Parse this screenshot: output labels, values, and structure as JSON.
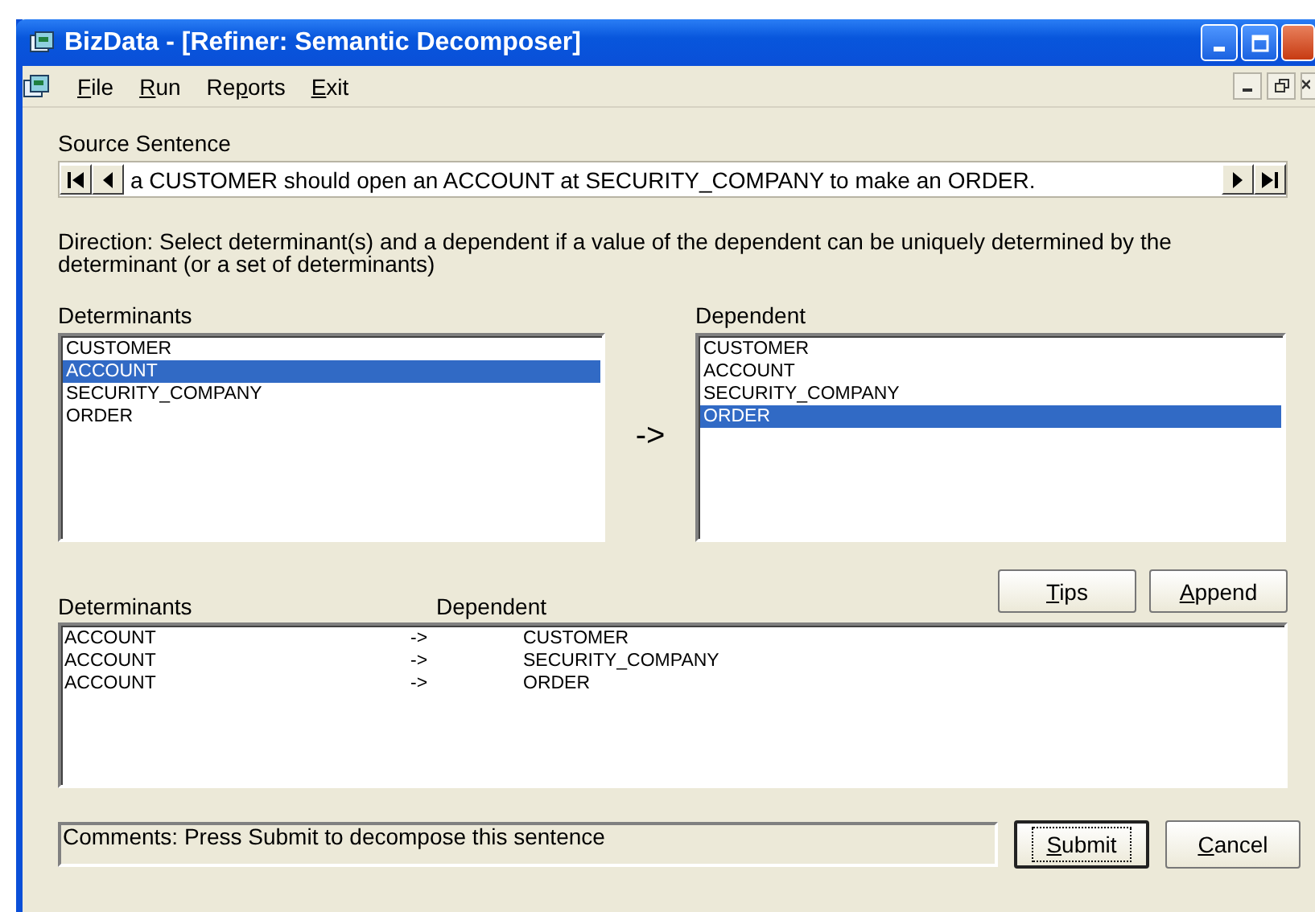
{
  "window": {
    "title": "BizData - [Refiner: Semantic Decomposer]"
  },
  "menu": [
    {
      "key": "F",
      "rest": "ile"
    },
    {
      "key": "R",
      "rest": "un"
    },
    {
      "lead": "Re",
      "key": "p",
      "rest": "orts"
    },
    {
      "key": "E",
      "rest": "xit"
    }
  ],
  "source": {
    "label": "Source Sentence",
    "sentence": "a CUSTOMER should open an ACCOUNT at SECURITY_COMPANY to make an ORDER."
  },
  "direction": "Direction: Select determinant(s) and a dependent if a value of the dependent can be uniquely determined by the determinant (or a set of determinants)",
  "determinants": {
    "label": "Determinants",
    "items": [
      {
        "text": "CUSTOMER",
        "selected": false
      },
      {
        "text": "ACCOUNT",
        "selected": true
      },
      {
        "text": "SECURITY_COMPANY",
        "selected": false
      },
      {
        "text": "ORDER",
        "selected": false
      }
    ]
  },
  "arrow": "->",
  "dependent": {
    "label": "Dependent",
    "items": [
      {
        "text": "CUSTOMER",
        "selected": false
      },
      {
        "text": "ACCOUNT",
        "selected": false
      },
      {
        "text": "SECURITY_COMPANY",
        "selected": false
      },
      {
        "text": "ORDER",
        "selected": true
      }
    ]
  },
  "actions": [
    {
      "key": "T",
      "rest": "ips"
    },
    {
      "key": "A",
      "rest": "ppend"
    }
  ],
  "results": {
    "columns": [
      "Determinants",
      "Dependent"
    ],
    "rows": [
      {
        "determinant": "ACCOUNT",
        "arrow": "->",
        "dependent": "CUSTOMER"
      },
      {
        "determinant": "ACCOUNT",
        "arrow": "->",
        "dependent": "SECURITY_COMPANY"
      },
      {
        "determinant": "ACCOUNT",
        "arrow": "->",
        "dependent": "ORDER"
      }
    ]
  },
  "comments": "Comments: Press Submit to decompose this sentence",
  "buttons": [
    {
      "key": "S",
      "rest": "ubmit",
      "focused": true
    },
    {
      "key": "C",
      "rest": "ancel",
      "focused": false
    }
  ]
}
